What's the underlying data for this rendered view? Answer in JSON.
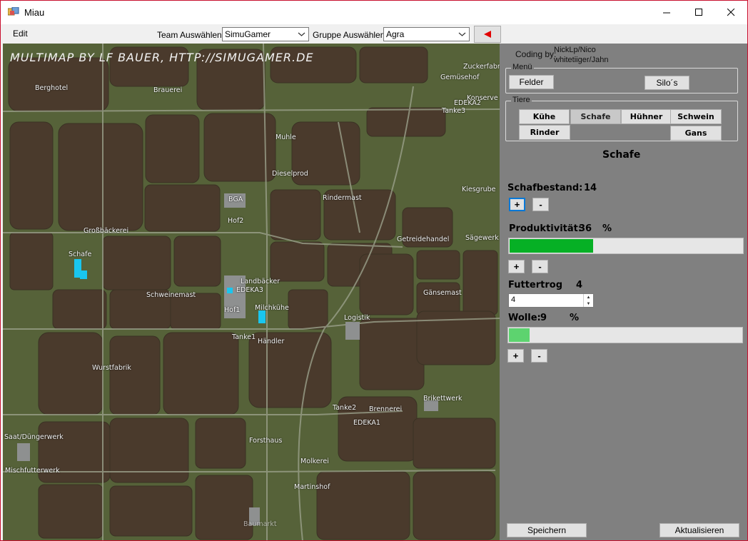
{
  "window": {
    "title": "Miau"
  },
  "menu": {
    "edit": "Edit"
  },
  "toolbar": {
    "team_label": "Team Auswählen:",
    "team_value": "SimuGamer",
    "group_label": "Gruppe Auswählen:",
    "group_value": "Agra",
    "back_icon": "red-left-arrow-icon"
  },
  "map": {
    "title": "MULTIMAP BY LF BAUER, HTTP://SIMUGAMER.DE",
    "labels": [
      "Zuckerfabr",
      "Gemüsehof",
      "Berghotel",
      "Brauerei",
      "Konserve",
      "EDEKA2",
      "Tanke3",
      "Muhle",
      "Dieselprod",
      "BGA",
      "Rindermast",
      "Kiesgrube",
      "Hof2",
      "Großbäckerei",
      "Getreidehandel",
      "Sägewerk",
      "Schafe",
      "Landbäcker",
      "EDEKA3",
      "Schweinemast",
      "Gänsemast",
      "Milchkühe",
      "Hof1",
      "Logistik",
      "Tanke1",
      "Händler",
      "Wurstfabrik",
      "Brikettwerk",
      "Tanke2",
      "Brennerei",
      "EDEKA1",
      "Saat/Düngerwerk",
      "Forsthaus",
      "Molkerei",
      "Mischfutterwerk",
      "Martinshof",
      "Baumarkt"
    ]
  },
  "panel": {
    "coding_label": "Coding by:",
    "coding_names": [
      "NickLp/Nico",
      "whitetiiger/Jahn"
    ],
    "menu_group": {
      "title": "Menü",
      "felder": "Felder",
      "silos": "Silo´s"
    },
    "tiere_group": {
      "title": "Tiere",
      "buttons": [
        "Kühe",
        "Schafe",
        "Hühner",
        "Schwein",
        "Rinder",
        "Gans"
      ],
      "selected": "Schafe"
    },
    "section_title": "Schafe",
    "bestand": {
      "label": "Schafbestand:",
      "value": "14"
    },
    "produktivitaet": {
      "label": "Produktivität:",
      "value": "36",
      "unit": "%",
      "fraction": 0.36,
      "color": "#06b025"
    },
    "futtertrog": {
      "label": "Futtertrog",
      "value": "4",
      "input_value": "4"
    },
    "wolle": {
      "label": "Wolle:",
      "value": "9",
      "unit": "%",
      "fraction": 0.09,
      "color": "#5dd36f"
    },
    "plus": "+",
    "minus": "-",
    "save": "Speichern",
    "refresh": "Aktualisieren"
  }
}
